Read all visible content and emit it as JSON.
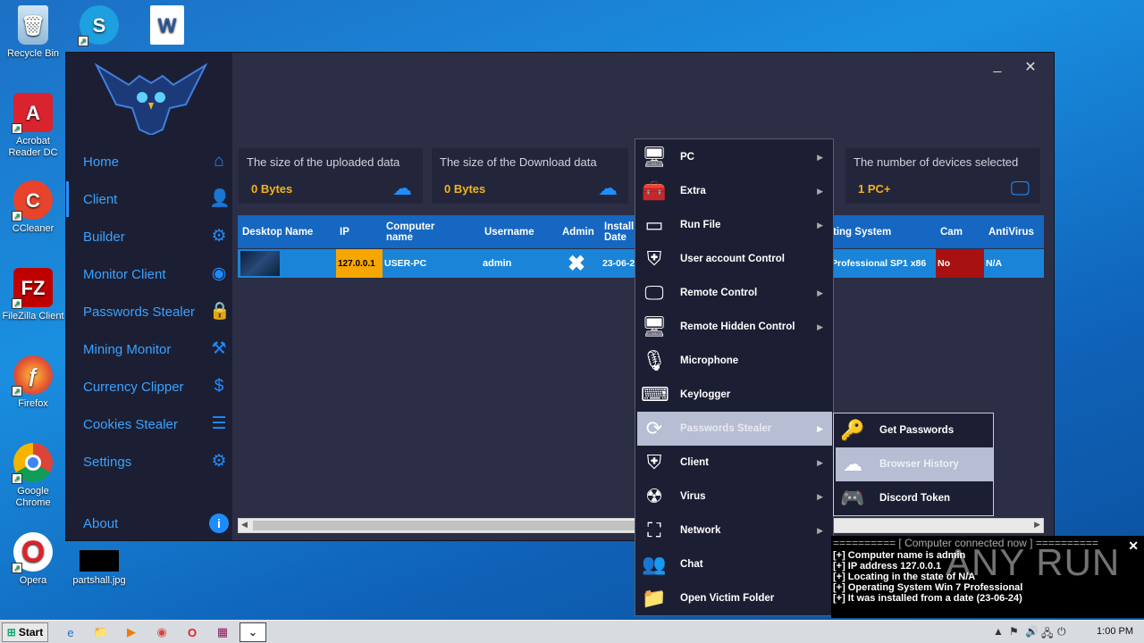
{
  "desktop": {
    "icons": [
      {
        "label": "Recycle Bin"
      },
      {
        "label": "Acrobat Reader DC"
      },
      {
        "label": "CCleaner"
      },
      {
        "label": "FileZilla Client"
      },
      {
        "label": "Firefox"
      },
      {
        "label": "Google Chrome"
      },
      {
        "label": "Opera"
      },
      {
        "label": "partshall.jpg"
      }
    ]
  },
  "sidebar": {
    "items": [
      {
        "label": "Home",
        "icon": "home-icon"
      },
      {
        "label": "Client",
        "icon": "user-icon"
      },
      {
        "label": "Builder",
        "icon": "gear-icon"
      },
      {
        "label": "Monitor Client",
        "icon": "eye-icon"
      },
      {
        "label": "Passwords Stealer",
        "icon": "lock-icon"
      },
      {
        "label": "Mining Monitor",
        "icon": "pickaxe-icon"
      },
      {
        "label": "Currency Clipper",
        "icon": "dollar-icon"
      },
      {
        "label": "Cookies Stealer",
        "icon": "list-icon"
      },
      {
        "label": "Settings",
        "icon": "user-settings-icon"
      },
      {
        "label": "About",
        "icon": "info-icon"
      }
    ]
  },
  "stats": [
    {
      "label": "The size of the uploaded data",
      "value": "0 Bytes"
    },
    {
      "label": "The size of the Download data",
      "value": "0 Bytes"
    },
    {
      "label": "The number of devices selected",
      "value": "1 PC+"
    }
  ],
  "table": {
    "headers": [
      "Desktop",
      "Name",
      "IP",
      "Computer name",
      "Username",
      "Admin",
      "Install Date",
      "ting System",
      "Cam",
      "AntiVirus"
    ],
    "row": {
      "ip": "127.0.0.1",
      "computer_name": "USER-PC",
      "username": "admin",
      "admin": "✖",
      "install_date": "23-06-2",
      "os": "Professional SP1 x86",
      "cam": "No",
      "antivirus": "N/A"
    }
  },
  "context_menu": {
    "items": [
      {
        "label": "PC",
        "submenu": true
      },
      {
        "label": "Extra",
        "submenu": true
      },
      {
        "label": "Run File",
        "submenu": true
      },
      {
        "label": "User account Control",
        "submenu": false
      },
      {
        "label": "Remote Control",
        "submenu": true
      },
      {
        "label": "Remote Hidden Control",
        "submenu": true
      },
      {
        "label": "Microphone",
        "submenu": false
      },
      {
        "label": "Keylogger",
        "submenu": false
      },
      {
        "label": "Passwords Stealer",
        "submenu": true
      },
      {
        "label": "Client",
        "submenu": true
      },
      {
        "label": "Virus",
        "submenu": true
      },
      {
        "label": "Network",
        "submenu": true
      },
      {
        "label": "Chat",
        "submenu": false
      },
      {
        "label": "Open Victim Folder",
        "submenu": false
      }
    ],
    "submenu": [
      {
        "label": "Get Passwords"
      },
      {
        "label": "Browser History"
      },
      {
        "label": "Discord Token"
      }
    ]
  },
  "notification": {
    "header": "========== [ Computer connected now ] ==========",
    "lines": [
      "[+] Computer name is admin",
      "[+] IP address 127.0.0.1",
      "[+] Locating in the state of N/A",
      "[+] Operating System Win 7 Professional",
      "[+] It was installed from a date (23-06-24)"
    ]
  },
  "watermark": "ANY RUN",
  "taskbar": {
    "start_label": "Start",
    "clock": "1:00 PM"
  },
  "colors": {
    "accent": "#1e8cff",
    "value": "#f2b31c",
    "header": "#1567c2",
    "row": "#1a85d8"
  }
}
